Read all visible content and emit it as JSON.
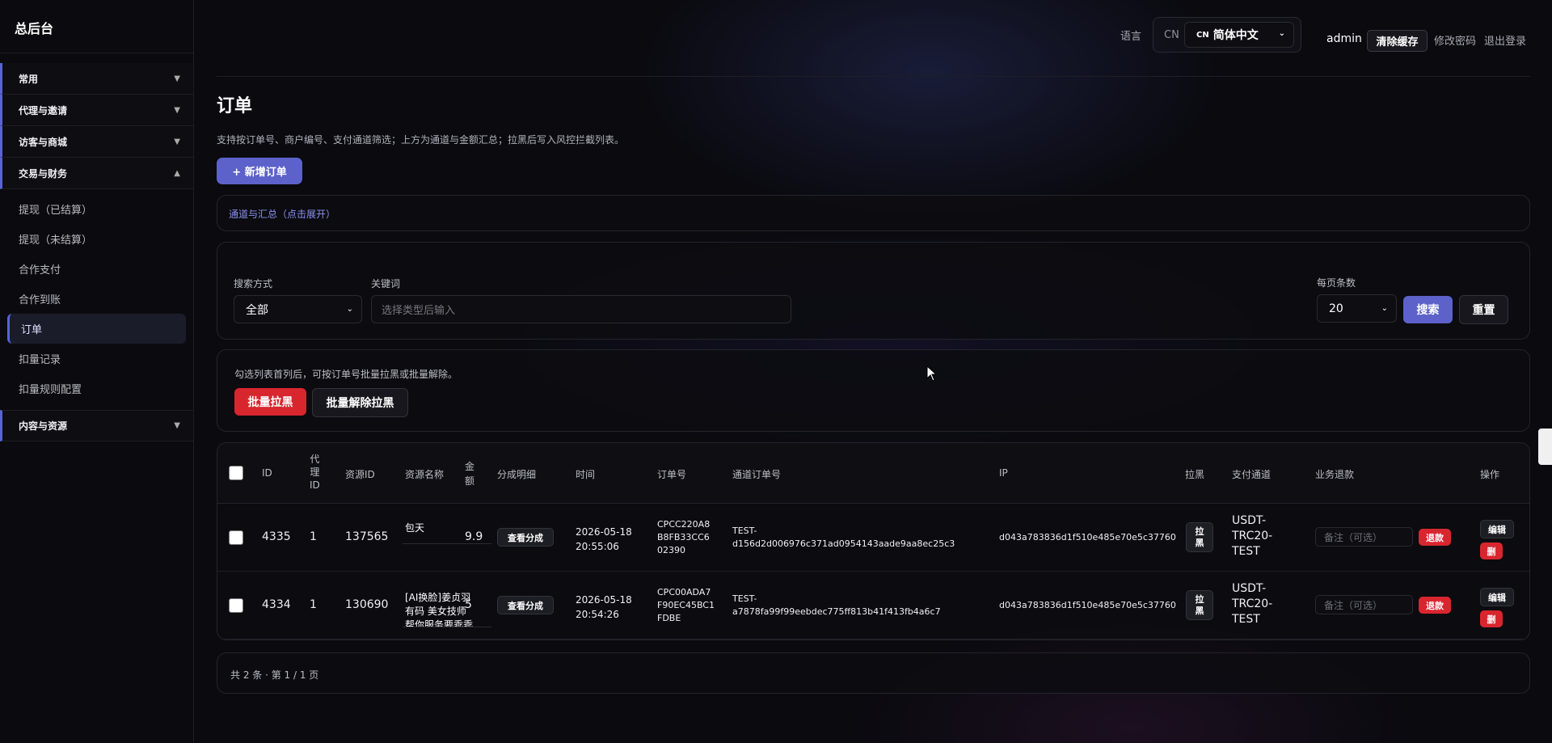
{
  "sidebar": {
    "brand": "总后台",
    "groups": [
      {
        "label": "常用",
        "chevron": "▼"
      },
      {
        "label": "代理与邀请",
        "chevron": "▼"
      },
      {
        "label": "访客与商城",
        "chevron": "▼"
      },
      {
        "label": "交易与财务",
        "chevron": "▲"
      },
      {
        "label": "内容与资源",
        "chevron": "▼"
      }
    ],
    "finance_items": [
      "提现（已结算）",
      "提现（未结算）",
      "合作支付",
      "合作到账",
      "订单",
      "扣量记录",
      "扣量规则配置"
    ]
  },
  "header": {
    "lang_label": "语言",
    "lang_code": "CN",
    "lang_flag": "CN",
    "lang_value": "简体中文",
    "user": "admin",
    "clear_cache": "清除缓存",
    "change_password": "修改密码",
    "logout": "退出登录"
  },
  "page": {
    "title": "订单",
    "description": "支持按订单号、商户编号、支付通道筛选；上方为通道与金额汇总；拉黑后写入风控拦截列表。",
    "add_button": "+ 新增订单",
    "summary_link": "通道与汇总（点击展开）"
  },
  "filter": {
    "search_mode_label": "搜索方式",
    "search_mode_value": "全部",
    "keyword_label": "关键词",
    "keyword_placeholder": "选择类型后输入",
    "page_size_label": "每页条数",
    "page_size_value": "20",
    "search_button": "搜索",
    "reset_button": "重置"
  },
  "batch": {
    "hint": "勾选列表首列后，可按订单号批量拉黑或批量解除。",
    "block_button": "批量拉黑",
    "unblock_button": "批量解除拉黑"
  },
  "table": {
    "headers": {
      "id": "ID",
      "agent_id": "代\n理\nID",
      "resource_id": "资源ID",
      "resource_name": "资源名称",
      "amount": "金\n额",
      "split": "分成明细",
      "time": "时间",
      "order_no": "订单号",
      "channel_order_no": "通道订单号",
      "ip": "IP",
      "block": "拉黑",
      "pay_channel": "支付通道",
      "refund": "业务退款",
      "actions": "操作"
    },
    "rows": [
      {
        "id": "4335",
        "agent_id": "1",
        "resource_id": "137565",
        "resource_name": "包天",
        "amount": "9.9",
        "split_button": "查看分成",
        "time_date": "2026-05-18",
        "time_clock": "20:55:06",
        "order_no": "CPCC220A8\nB8FB33CC6\n02390",
        "channel_order_no": "TEST-\nd156d2d006976c371ad0954143aade9aa8ec25c3",
        "ip": "d043a783836d1f510e485e70e5c37760",
        "block_button": "拉\n黑",
        "pay_channel": "USDT-\nTRC20-\nTEST",
        "note_placeholder": "备注（可选）",
        "refund_button": "退款",
        "edit_button": "编辑",
        "delete_button": "删"
      },
      {
        "id": "4334",
        "agent_id": "1",
        "resource_id": "130690",
        "resource_name": "[AI换脸]姜贞羽有码 美女技师帮你服务要乖乖",
        "amount": "5",
        "split_button": "查看分成",
        "time_date": "2026-05-18",
        "time_clock": "20:54:26",
        "order_no": "CPC00ADA7\nF90EC45BC1\nFDBE",
        "channel_order_no": "TEST-\na7878fa99f99eebdec775ff813b41f413fb4a6c7",
        "ip": "d043a783836d1f510e485e70e5c37760",
        "block_button": "拉\n黑",
        "pay_channel": "USDT-\nTRC20-\nTEST",
        "note_placeholder": "备注（可选）",
        "refund_button": "退款",
        "edit_button": "编辑",
        "delete_button": "删"
      }
    ]
  },
  "pagination": {
    "summary": "共 2 条 · 第 1 / 1 页"
  }
}
